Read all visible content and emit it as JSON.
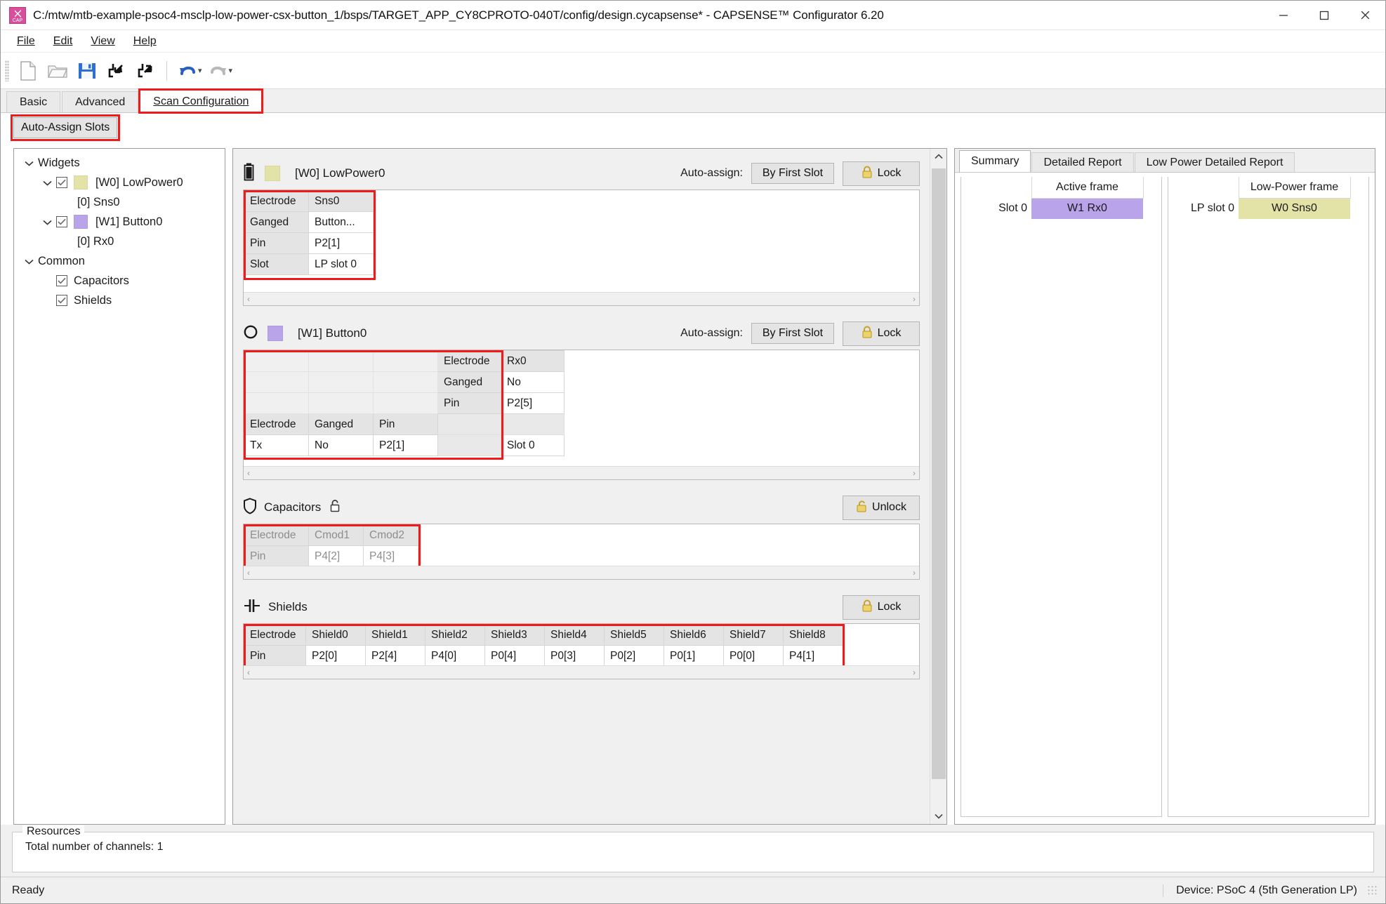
{
  "window": {
    "title": "C:/mtw/mtb-example-psoc4-msclp-low-power-csx-button_1/bsps/TARGET_APP_CY8CPROTO-040T/config/design.cycapsense* - CAPSENSE™ Configurator 6.20",
    "app_icon": "capsense-icon",
    "minimize": "–",
    "maximize": "☐",
    "close": "✕"
  },
  "menu": {
    "items": [
      "File",
      "Edit",
      "View",
      "Help"
    ]
  },
  "toolbar": {
    "buttons": [
      {
        "name": "new-file-icon",
        "label": "New"
      },
      {
        "name": "open-folder-icon",
        "label": "Open"
      },
      {
        "name": "save-icon",
        "label": "Save"
      },
      {
        "name": "import-icon",
        "label": "Import"
      },
      {
        "name": "export-icon",
        "label": "Export"
      },
      {
        "name": "undo-icon",
        "label": "Undo"
      },
      {
        "name": "redo-icon",
        "label": "Redo"
      }
    ]
  },
  "tabs": {
    "items": [
      "Basic",
      "Advanced",
      "Scan Configuration"
    ],
    "active": "Scan Configuration"
  },
  "actions": {
    "auto_assign_slots": "Auto-Assign Slots"
  },
  "tree": {
    "nodes": [
      {
        "label": "Widgets",
        "indent": 0,
        "chevron": true,
        "checkbox": false,
        "swatch": null
      },
      {
        "label": "[W0] LowPower0",
        "indent": 1,
        "chevron": true,
        "checkbox": true,
        "swatch": "#e3e3a8"
      },
      {
        "label": "[0] Sns0",
        "indent": 2,
        "chevron": false,
        "checkbox": false,
        "swatch": null
      },
      {
        "label": "[W1] Button0",
        "indent": 1,
        "chevron": true,
        "checkbox": true,
        "swatch": "#b9a4ea"
      },
      {
        "label": "[0] Rx0",
        "indent": 2,
        "chevron": false,
        "checkbox": false,
        "swatch": null
      },
      {
        "label": "Common",
        "indent": 0,
        "chevron": true,
        "checkbox": false,
        "swatch": null
      },
      {
        "label": "Capacitors",
        "indent": 2,
        "chevron": false,
        "checkbox": true,
        "swatch": null
      },
      {
        "label": "Shields",
        "indent": 2,
        "chevron": false,
        "checkbox": true,
        "swatch": null
      }
    ]
  },
  "sections": {
    "lowpower": {
      "icon": "battery-icon",
      "swatch": "#e3e3a8",
      "title": "[W0] LowPower0",
      "auto_assign_label": "Auto-assign:",
      "by_first_slot": "By First Slot",
      "lock": "Lock",
      "rows": [
        {
          "label": "Electrode",
          "value": "Sns0",
          "header": true
        },
        {
          "label": "Ganged",
          "value": "Button...",
          "header": false
        },
        {
          "label": "Pin",
          "value": "P2[1]",
          "header": false
        },
        {
          "label": "Slot",
          "value": "LP slot 0",
          "header": false
        }
      ]
    },
    "button": {
      "icon": "circle-icon",
      "swatch": "#b9a4ea",
      "title": "[W1] Button0",
      "auto_assign_label": "Auto-assign:",
      "by_first_slot": "By First Slot",
      "lock": "Lock",
      "rx_rows": [
        {
          "label": "Electrode",
          "value": "Rx0"
        },
        {
          "label": "Ganged",
          "value": "No"
        },
        {
          "label": "Pin",
          "value": "P2[5]"
        }
      ],
      "tx_headers": [
        "Electrode",
        "Ganged",
        "Pin"
      ],
      "tx_values": [
        "Tx",
        "No",
        "P2[1]"
      ],
      "slot_value": "Slot 0"
    },
    "capacitors": {
      "icon": "shield-outline-icon",
      "lock_icon": "lock-open-small-icon",
      "title": "Capacitors",
      "unlock": "Unlock",
      "headers": [
        "Electrode",
        "Cmod1",
        "Cmod2"
      ],
      "pins": [
        "Pin",
        "P4[2]",
        "P4[3]"
      ]
    },
    "shields": {
      "icon": "capacitor-icon",
      "title": "Shields",
      "lock": "Lock",
      "headers": [
        "Electrode",
        "Shield0",
        "Shield1",
        "Shield2",
        "Shield3",
        "Shield4",
        "Shield5",
        "Shield6",
        "Shield7",
        "Shield8"
      ],
      "pins": [
        "Pin",
        "P2[0]",
        "P2[4]",
        "P4[0]",
        "P0[4]",
        "P0[3]",
        "P0[2]",
        "P0[1]",
        "P0[0]",
        "P4[1]"
      ]
    }
  },
  "summary": {
    "tabs": [
      "Summary",
      "Detailed Report",
      "Low Power Detailed Report"
    ],
    "active": "Summary",
    "active_frame": {
      "header": "Active frame",
      "slot_label": "Slot 0",
      "cell": "W1 Rx0",
      "cell_color": "#b9a4ea"
    },
    "lowpower_frame": {
      "header": "Low-Power frame",
      "slot_label": "LP slot 0",
      "cell": "W0 Sns0",
      "cell_color": "#e3e3a8"
    }
  },
  "resources": {
    "legend": "Resources",
    "text": "Total number of channels: 1"
  },
  "statusbar": {
    "left": "Ready",
    "right": "Device: PSoC 4 (5th Generation LP)"
  },
  "colors": {
    "highlight": "#ef1b1b",
    "lowpower_swatch": "#e3e3a8",
    "button_swatch": "#b9a4ea"
  }
}
